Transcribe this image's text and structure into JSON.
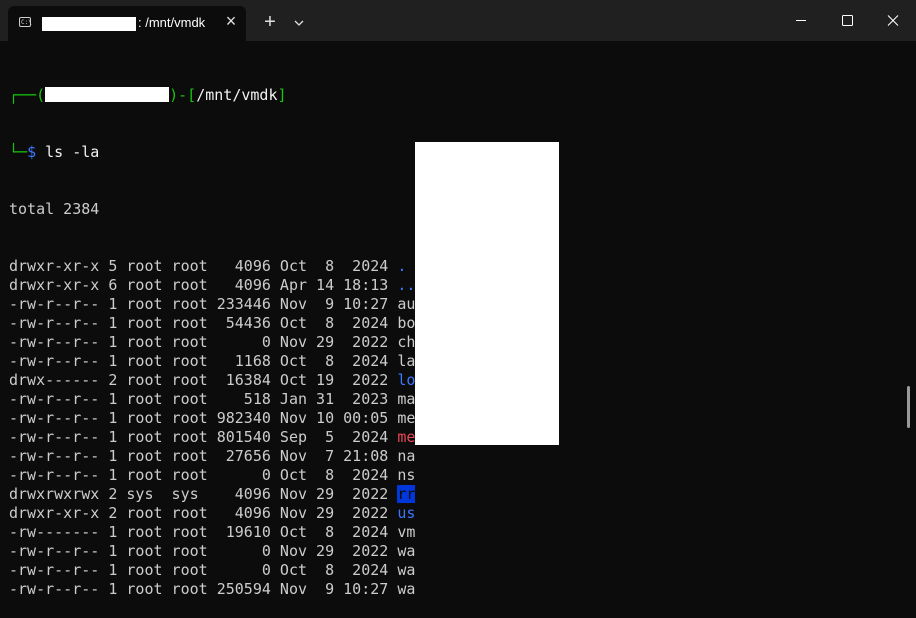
{
  "window": {
    "tab_title": ": /mnt/vmdk",
    "close_tab_glyph": "×",
    "new_tab_glyph": "+",
    "dropdown_icon": "chevron-down-icon",
    "min_icon": "minimize-icon",
    "max_icon": "maximize-icon",
    "close_icon": "close-icon"
  },
  "prompt": {
    "open": "┌──(",
    "mid": ")-[",
    "path": "/mnt/vmdk",
    "close": "]",
    "corner": "└─",
    "symbol": "$",
    "command": " ls -la"
  },
  "total": "total 2384",
  "entries": [
    {
      "meta": "drwxr-xr-x 5 root root   4096 Oct  8  2024 ",
      "name": ".",
      "style": "dir"
    },
    {
      "meta": "drwxr-xr-x 6 root root   4096 Apr 14 18:13 ",
      "name": "..",
      "style": "dir"
    },
    {
      "meta": "-rw-r--r-- 1 root root 233446 Nov  9 10:27 ",
      "name": "au",
      "style": "file"
    },
    {
      "meta": "-rw-r--r-- 1 root root  54436 Oct  8  2024 ",
      "name": "bo",
      "style": "file"
    },
    {
      "meta": "-rw-r--r-- 1 root root      0 Nov 29  2022 ",
      "name": "ch",
      "style": "file"
    },
    {
      "meta": "-rw-r--r-- 1 root root   1168 Oct  8  2024 ",
      "name": "la",
      "style": "file"
    },
    {
      "meta": "drwx------ 2 root root  16384 Oct 19  2022 ",
      "name": "lo",
      "style": "dir"
    },
    {
      "meta": "-rw-r--r-- 1 root root    518 Jan 31  2023 ",
      "name": "ma",
      "style": "file"
    },
    {
      "meta": "-rw-r--r-- 1 root root 982340 Nov 10 00:05 ",
      "name": "me",
      "style": "file"
    },
    {
      "meta": "-rw-r--r-- 1 root root 801540 Sep  5  2024 ",
      "name": "me",
      "style": "archive"
    },
    {
      "meta": "-rw-r--r-- 1 root root  27656 Nov  7 21:08 ",
      "name": "na",
      "style": "file"
    },
    {
      "meta": "-rw-r--r-- 1 root root      0 Oct  8  2024 ",
      "name": "ns",
      "style": "file"
    },
    {
      "meta": "drwxrwxrwx 2 sys  sys    4096 Nov 29  2022 ",
      "name": "rr",
      "style": "world"
    },
    {
      "meta": "drwxr-xr-x 2 root root   4096 Nov 29  2022 ",
      "name": "us",
      "style": "dir"
    },
    {
      "meta": "-rw------- 1 root root  19610 Oct  8  2024 ",
      "name": "vm",
      "style": "file"
    },
    {
      "meta": "-rw-r--r-- 1 root root      0 Nov 29  2022 ",
      "name": "wa",
      "style": "file"
    },
    {
      "meta": "-rw-r--r-- 1 root root      0 Oct  8  2024 ",
      "name": "wa",
      "style": "file"
    },
    {
      "meta": "-rw-r--r-- 1 root root 250594 Nov  9 10:27 ",
      "name": "wa",
      "style": "file"
    }
  ],
  "colors": {
    "background": "#0c0c0c",
    "titlebar": "#202020",
    "prompt_green": "#16c60c",
    "dir_blue": "#3b78ff",
    "archive_red": "#e74856",
    "world_writable_bg": "#0037da",
    "text": "#cccccc"
  }
}
